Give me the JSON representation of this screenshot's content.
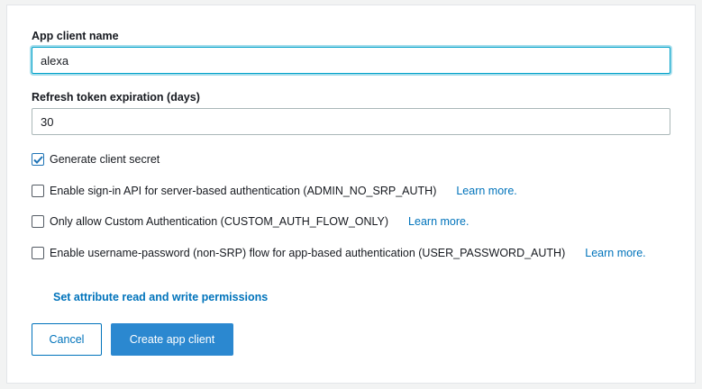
{
  "form": {
    "app_client_name_label": "App client name",
    "app_client_name_value": "alexa",
    "refresh_token_label": "Refresh token expiration (days)",
    "refresh_token_value": "30",
    "options": [
      {
        "label": "Generate client secret",
        "checked": true,
        "link": ""
      },
      {
        "label": "Enable sign-in API for server-based authentication (ADMIN_NO_SRP_AUTH)",
        "checked": false,
        "link": "Learn more."
      },
      {
        "label": "Only allow Custom Authentication (CUSTOM_AUTH_FLOW_ONLY)",
        "checked": false,
        "link": "Learn more."
      },
      {
        "label": "Enable username-password (non-SRP) flow for app-based authentication (USER_PASSWORD_AUTH)",
        "checked": false,
        "link": "Learn more."
      }
    ],
    "attribute_permissions_link": "Set attribute read and write permissions",
    "cancel_label": "Cancel",
    "create_label": "Create app client"
  },
  "colors": {
    "accent": "#0073bb",
    "primary_button": "#2b88d0",
    "focus_ring": "#00a1c9"
  },
  "icons": {
    "checkbox_checked": "checkmark-icon"
  }
}
